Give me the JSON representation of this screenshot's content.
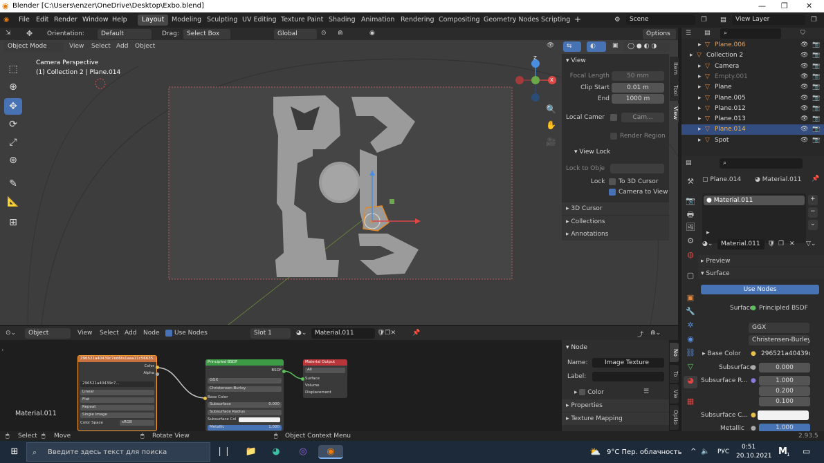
{
  "titlebar": {
    "title": "Blender [C:\\Users\\enzer\\OneDrive\\Desktop\\Exbo.blend]"
  },
  "menu": {
    "file": "File",
    "edit": "Edit",
    "render": "Render",
    "window": "Window",
    "help": "Help"
  },
  "workspaces": [
    "Layout",
    "Modeling",
    "Sculpting",
    "UV Editing",
    "Texture Paint",
    "Shading",
    "Animation",
    "Rendering",
    "Compositing",
    "Geometry Nodes",
    "Scripting"
  ],
  "scene": {
    "label": "Scene",
    "view_layer": "View Layer"
  },
  "tool_header": {
    "orientation_label": "Orientation:",
    "orientation": "Default",
    "drag_label": "Drag:",
    "drag": "Select Box",
    "transform": "Global",
    "options": "Options"
  },
  "viewport_header": {
    "mode": "Object Mode",
    "view": "View",
    "select": "Select",
    "add": "Add",
    "object": "Object"
  },
  "viewport": {
    "camera_text": "Camera Perspective",
    "collection_text": "(1) Collection 2 | Plane.014"
  },
  "npanel": {
    "view_header": "View",
    "focal_length_label": "Focal Length",
    "focal_length": "50 mm",
    "clip_start_label": "Clip Start",
    "clip_start": "0.01 m",
    "end_label": "End",
    "end": "1000 m",
    "local_camera_label": "Local Camer",
    "local_camera_value": "Cam...",
    "render_region": "Render Region",
    "view_lock_header": "View Lock",
    "lock_to_object_label": "Lock to Obje",
    "lock_label": "Lock",
    "to_3d_cursor": "To 3D Cursor",
    "camera_to_view": "Camera to View",
    "cursor_3d": "3D Cursor",
    "collections": "Collections",
    "annotations": "Annotations",
    "tabs": [
      "Item",
      "Tool",
      "View"
    ]
  },
  "outliner": {
    "rows": [
      {
        "name": "Plane.006",
        "indent": 1,
        "selected": false,
        "color": "#e7a05a"
      },
      {
        "name": "Collection 2",
        "indent": 0,
        "selected": false,
        "color": "#ddd"
      },
      {
        "name": "Camera",
        "indent": 1,
        "selected": false,
        "color": "#ddd"
      },
      {
        "name": "Empty.001",
        "indent": 1,
        "selected": false,
        "color": "#777"
      },
      {
        "name": "Plane",
        "indent": 1,
        "selected": false,
        "color": "#ddd"
      },
      {
        "name": "Plane.005",
        "indent": 1,
        "selected": false,
        "color": "#ddd"
      },
      {
        "name": "Plane.012",
        "indent": 1,
        "selected": false,
        "color": "#ddd"
      },
      {
        "name": "Plane.013",
        "indent": 1,
        "selected": false,
        "color": "#ddd"
      },
      {
        "name": "Plane.014",
        "indent": 1,
        "selected": true,
        "color": "#ffb33a"
      },
      {
        "name": "Spot",
        "indent": 1,
        "selected": false,
        "color": "#ddd"
      }
    ]
  },
  "properties": {
    "object": "Plane.014",
    "material": "Material.011",
    "slot_item": "Material.011",
    "material_field": "Material.011",
    "preview": "Preview",
    "surface_header": "Surface",
    "use_nodes": "Use Nodes",
    "surface_label": "Surface",
    "surface_value": "Principled BSDF",
    "distribution": "GGX",
    "subsurface_method": "Christensen-Burley",
    "base_color_label": "Base Color",
    "base_color_value": "296521a40439c7",
    "subsurface_label": "Subsurface",
    "subsurface_value": "0.000",
    "subsurface_radius_label": "Subsurface R...",
    "radius": [
      "1.000",
      "0.200",
      "0.100"
    ],
    "subsurface_color_label": "Subsurface C...",
    "metallic_label": "Metallic",
    "metallic_value": "1.000"
  },
  "node_header": {
    "editor": "Object",
    "view": "View",
    "select": "Select",
    "add": "Add",
    "node": "Node",
    "use_nodes": "Use Nodes",
    "slot": "Slot 1",
    "material": "Material.011"
  },
  "nodes": {
    "image_texture": {
      "title": "296521a40439c7ed6fa1aaa11c56635...",
      "color": "Color",
      "alpha": "Alpha",
      "image": "296521a40439c7...",
      "interp": "Linear",
      "proj": "Flat",
      "ext": "Repeat",
      "source": "Single Image",
      "cs_label": "Color Space",
      "cs_value": "sRGB"
    },
    "bsdf": {
      "title": "Principled BSDF",
      "out": "BSDF",
      "dist": "GGX",
      "sss": "Christensen-Burley",
      "base_color": "Base Color",
      "subsurface": "Subsurface",
      "subsurface_val": "0.000",
      "subsurface_radius": "Subsurface Radius",
      "subsurface_col": "Subsurface Col",
      "metallic": "Metallic",
      "metallic_val": "1.000"
    },
    "output": {
      "title": "Material Output",
      "target": "All",
      "surface": "Surface",
      "volume": "Volume",
      "displacement": "Displacement"
    }
  },
  "node_editor": {
    "material_label": "Material.011"
  },
  "node_npanel": {
    "header": "Node",
    "name_label": "Name:",
    "name_value": "Image Texture",
    "label_label": "Label:",
    "color": "Color",
    "properties": "Properties",
    "texture_mapping": "Texture Mapping",
    "tabs": [
      "No",
      "To",
      "Vie",
      "Optio"
    ]
  },
  "statusbar": {
    "select": "Select",
    "move": "Move",
    "rotate": "Rotate View",
    "context": "Object Context Menu",
    "version": "2.93.5"
  },
  "taskbar": {
    "search_placeholder": "Введите здесь текст для поиска",
    "weather": "9°C  Пер. облачность",
    "lang": "РУС",
    "time": "0:51",
    "date": "20.10.2021",
    "badge": "1"
  },
  "colors": {
    "accent": "#4772b3",
    "selected_outliner": "#334d80",
    "node_image_header": "#c9713e",
    "node_bsdf_header": "#3d9a45",
    "node_output_header": "#b8363a",
    "taskbar": "#1c2a3a"
  }
}
